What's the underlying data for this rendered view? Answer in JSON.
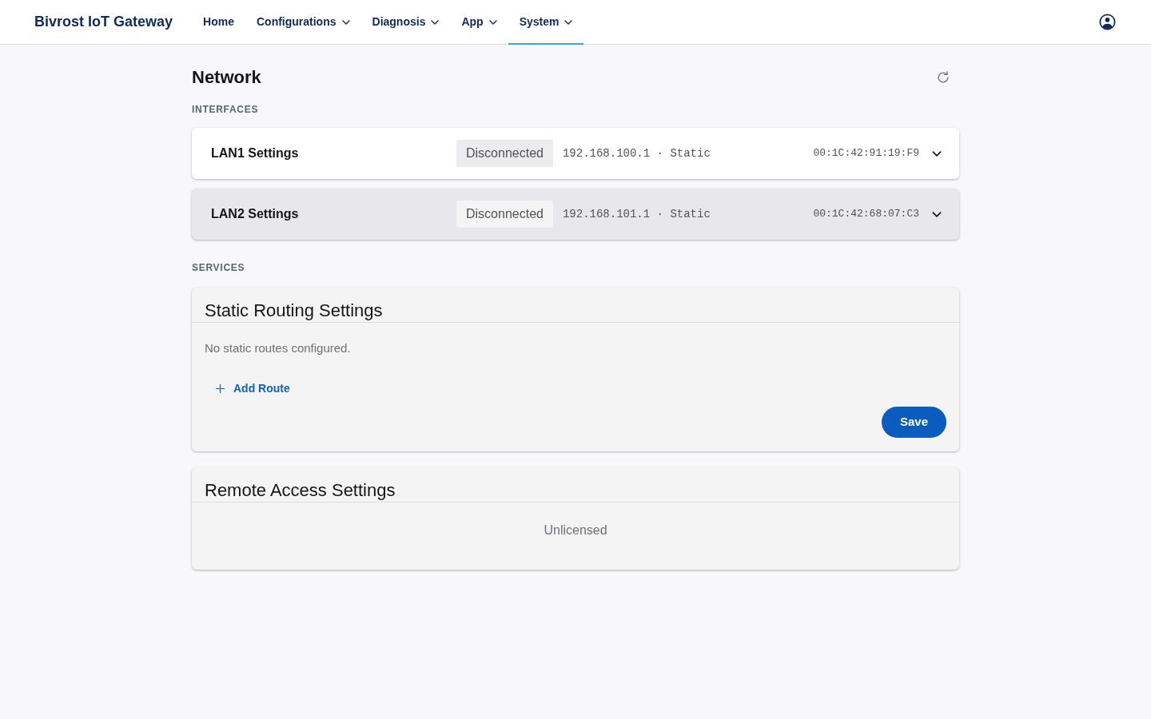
{
  "header": {
    "brand": "Bivrost IoT Gateway",
    "nav": [
      {
        "label": "Home",
        "kind": "link",
        "selected": false
      },
      {
        "label": "Configurations",
        "kind": "menu",
        "selected": false
      },
      {
        "label": "Diagnosis",
        "kind": "menu",
        "selected": false
      },
      {
        "label": "App",
        "kind": "menu",
        "selected": false
      },
      {
        "label": "System",
        "kind": "menu",
        "selected": true
      }
    ]
  },
  "page": {
    "title": "Network"
  },
  "interfaces": {
    "label": "INTERFACES",
    "items": [
      {
        "name": "LAN1 Settings",
        "status": "Disconnected",
        "address": "192.168.100.1 · Static",
        "mac": "00:1C:42:91:19:F9",
        "expanded": false,
        "selected": false
      },
      {
        "name": "LAN2 Settings",
        "status": "Disconnected",
        "address": "192.168.101.1 · Static",
        "mac": "00:1C:42:68:07:C3",
        "expanded": false,
        "selected": true
      }
    ]
  },
  "services": {
    "label": "SERVICES",
    "cards": [
      {
        "kind": "routing",
        "title": "Static Routing Settings",
        "message": "No static routes configured.",
        "add_button": "Add Route",
        "save_button": "Save"
      },
      {
        "kind": "remote",
        "title": "Remote Access Settings",
        "message": "Unlicensed"
      }
    ]
  }
}
